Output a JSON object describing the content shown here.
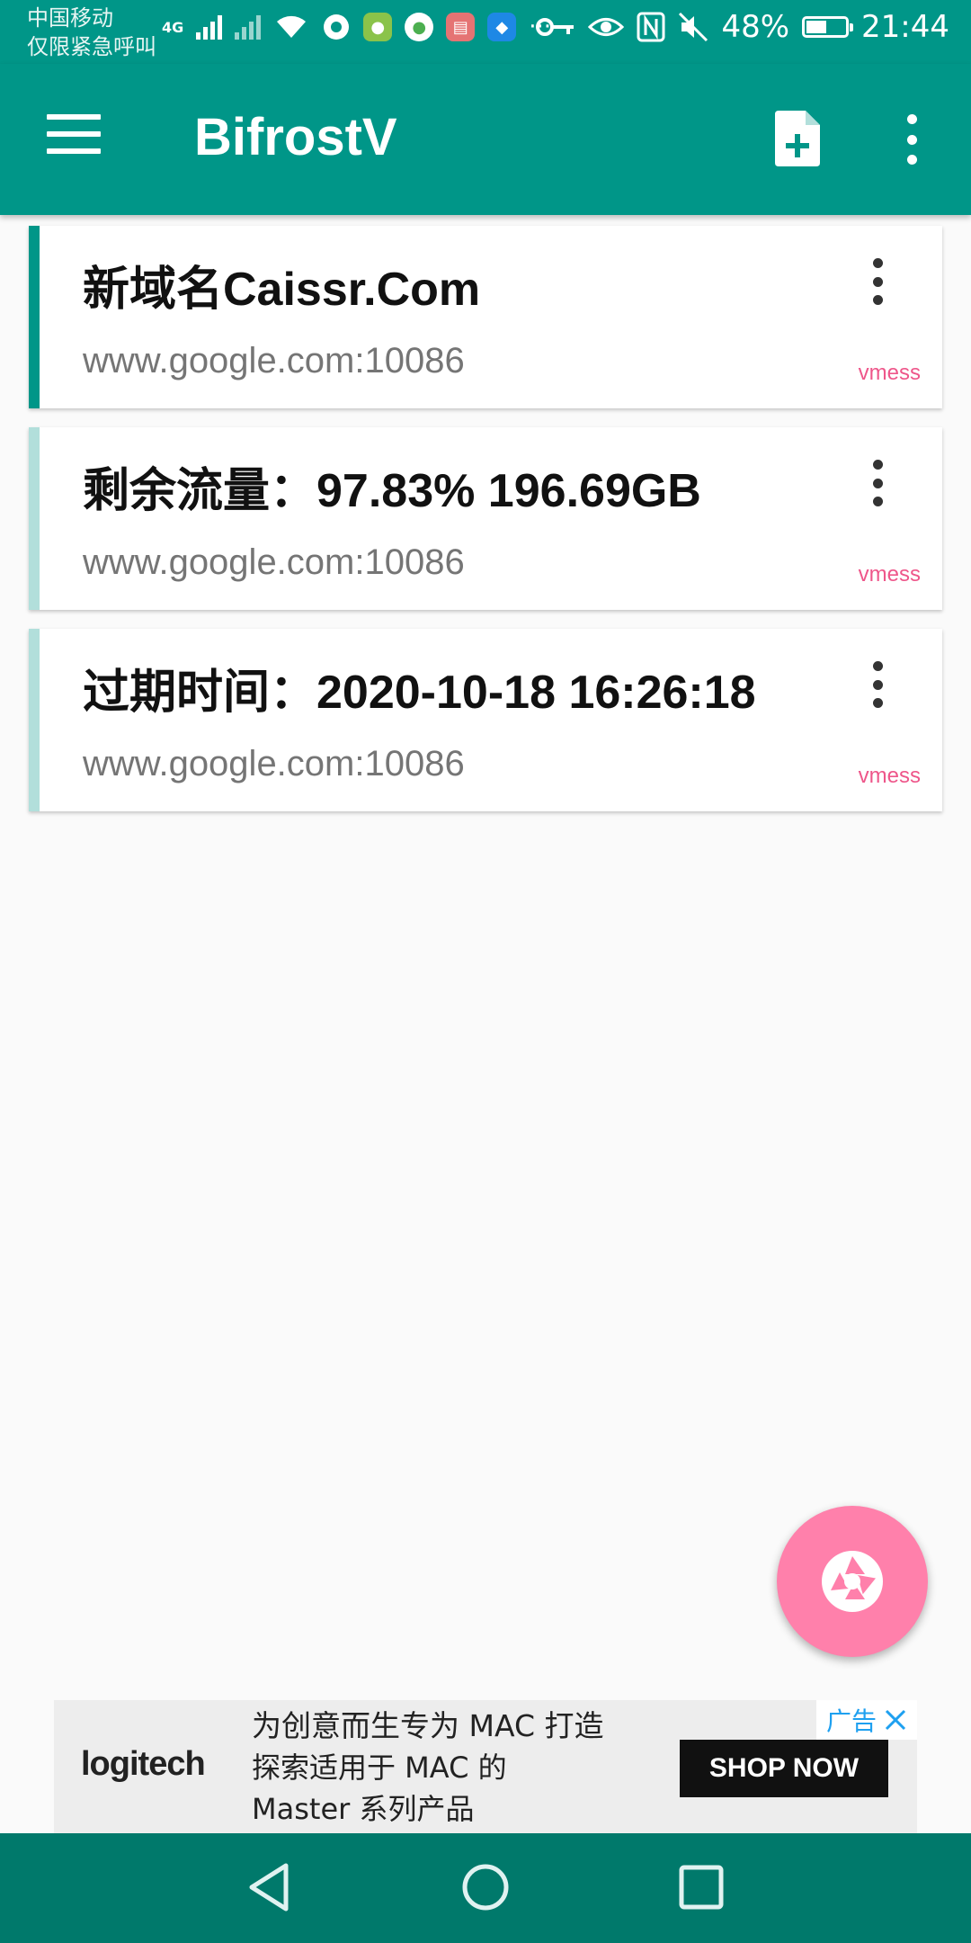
{
  "status_bar": {
    "carrier_line1": "中国移动",
    "carrier_line2": "仅限紧急呼叫",
    "network_type": "4G",
    "more_indicator": "···",
    "battery_percent": "48%",
    "battery_level": 0.48,
    "time": "21:44",
    "icons": [
      "signal-icon",
      "no-signal-icon",
      "wifi-icon",
      "app-icon-aperture",
      "app-icon-green",
      "app-icon-chat",
      "app-icon-book",
      "app-icon-shield",
      "key-icon",
      "eye-icon",
      "nfc-icon",
      "mute-icon",
      "battery-icon"
    ]
  },
  "app_bar": {
    "title": "BifrostV",
    "menu_icon": "hamburger-menu-icon",
    "add_icon": "add-file-icon",
    "overflow_icon": "more-vertical-icon"
  },
  "servers": [
    {
      "title": "新域名Caissr.Com",
      "address": "www.google.com:10086",
      "type": "vmess",
      "selected": true
    },
    {
      "title": "剩余流量：97.83% 196.69GB",
      "address": "www.google.com:10086",
      "type": "vmess",
      "selected": false
    },
    {
      "title": "过期时间：2020-10-18 16:26:18",
      "address": "www.google.com:10086",
      "type": "vmess",
      "selected": false
    }
  ],
  "fab": {
    "icon": "aperture-connect-icon"
  },
  "ad": {
    "brand": "logitech",
    "line1": "为创意而生专为 MAC 打造",
    "line2": "探索适用于 MAC 的",
    "line3": "Master 系列产品",
    "cta": "SHOP NOW",
    "badge": "广告"
  },
  "nav_bar": {
    "back_icon": "back-triangle-icon",
    "home_icon": "home-circle-icon",
    "recents_icon": "recents-square-icon"
  },
  "colors": {
    "primary": "#009688",
    "nav_bar": "#00796b",
    "fab": "#ff80ab",
    "selected_indicator": "#009688",
    "unselected_indicator": "#b2dfdb",
    "type_label": "#e91e63"
  }
}
